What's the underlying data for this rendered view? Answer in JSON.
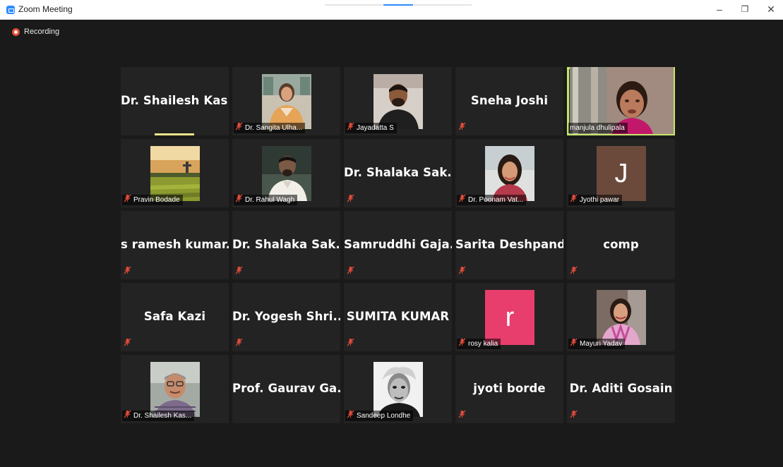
{
  "window": {
    "title": "Zoom Meeting",
    "controls": [
      "minimize-icon",
      "restore-icon",
      "close-icon"
    ]
  },
  "recording": {
    "label": "Recording"
  },
  "colors": {
    "speaking_outline": "#c7e66b",
    "recording_red": "#e14a36",
    "tile_bg": "#232323",
    "meeting_bg": "#1a1a1a"
  },
  "tiles": [
    {
      "name": "Dr. Shailesh Kas...",
      "video": false,
      "muted": false
    },
    {
      "name": "Dr. Sangita Ulha...",
      "video": true,
      "muted": true
    },
    {
      "name": "Jayadatta S",
      "video": true,
      "muted": true
    },
    {
      "name": "Sneha Joshi",
      "video": false,
      "muted": true
    },
    {
      "name": "manjula dhulipala",
      "video": true,
      "muted": false,
      "speaking": true
    },
    {
      "name": "Pravin Bodade",
      "video": true,
      "muted": true
    },
    {
      "name": "Dr. Rahul Wagh",
      "video": true,
      "muted": true
    },
    {
      "name": "Dr. Shalaka Sak...",
      "video": false,
      "muted": true
    },
    {
      "name": "Dr. Poonam Vat...",
      "video": true,
      "muted": true
    },
    {
      "name": "Jyothi pawar",
      "video": true,
      "muted": true,
      "avatar_letter": "J"
    },
    {
      "name": "s ramesh kumar...",
      "video": false,
      "muted": true
    },
    {
      "name": "Dr. Shalaka Sak...",
      "video": false,
      "muted": true
    },
    {
      "name": "Samruddhi Gaja...",
      "video": false,
      "muted": true
    },
    {
      "name": "Sarita Deshpande",
      "video": false,
      "muted": true
    },
    {
      "name": "comp",
      "video": false,
      "muted": true
    },
    {
      "name": "Safa Kazi",
      "video": false,
      "muted": true
    },
    {
      "name": "Dr. Yogesh Shri...",
      "video": false,
      "muted": true
    },
    {
      "name": "SUMITA KUMAR",
      "video": false,
      "muted": true
    },
    {
      "name": "rosy kalia",
      "video": true,
      "muted": true,
      "avatar_letter": "r"
    },
    {
      "name": "Mayuri Yadav",
      "video": true,
      "muted": true
    },
    {
      "name": "Dr. Shailesh Kas...",
      "video": true,
      "muted": true
    },
    {
      "name": "Prof. Gaurav Ga...",
      "video": false,
      "muted": false
    },
    {
      "name": "Sandeep Londhe",
      "video": true,
      "muted": true
    },
    {
      "name": "jyoti borde",
      "video": false,
      "muted": true
    },
    {
      "name": "Dr. Aditi Gosain",
      "video": false,
      "muted": true
    }
  ]
}
